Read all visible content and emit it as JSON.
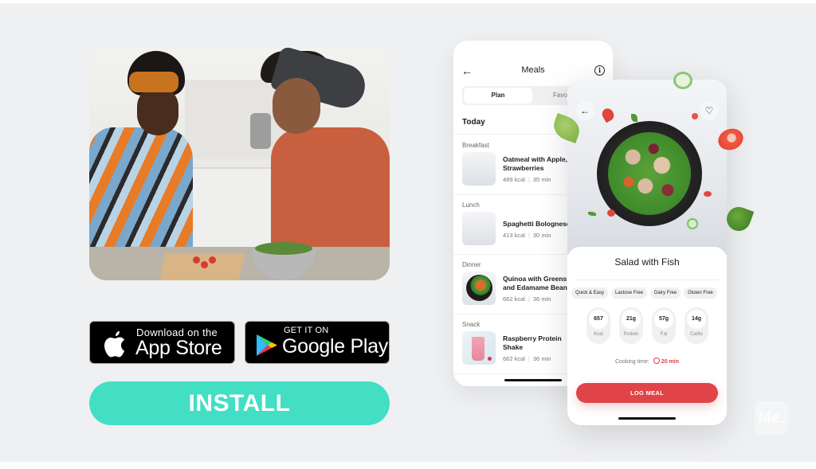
{
  "hero": {
    "alt": "Two women preparing a salad together in a kitchen"
  },
  "store_badges": {
    "apple": {
      "small": "Download on the",
      "big": "App Store",
      "icon": "apple-icon"
    },
    "google": {
      "small": "GET IT ON",
      "big": "Google Play",
      "icon": "google-play-icon"
    }
  },
  "install": {
    "label": "INSTALL",
    "color": "#42dfc4"
  },
  "meals_screen": {
    "back_icon": "←",
    "title": "Meals",
    "info_icon": "i",
    "tabs": [
      {
        "label": "Plan",
        "active": true
      },
      {
        "label": "Favo",
        "active": false
      }
    ],
    "section_title": "Today",
    "meals": [
      {
        "category": "Breakfast",
        "name_line1": "Oatmeal with Apple,",
        "name_line2": "Strawberries",
        "kcal": "489 kcal",
        "time": "35 min"
      },
      {
        "category": "Lunch",
        "name_line1": "Spaghetti Bolognese",
        "name_line2": "",
        "kcal": "413 kcal",
        "time": "30 min"
      },
      {
        "category": "Dinner",
        "name_line1": "Quinoa with Greens",
        "name_line2": "and Edamame Beans",
        "kcal": "662 kcal",
        "time": "36 min"
      },
      {
        "category": "Snack",
        "name_line1": "Raspberry Protein",
        "name_line2": "Shake",
        "kcal": "662 kcal",
        "time": "36 min"
      }
    ]
  },
  "detail_screen": {
    "back_icon": "←",
    "heart_icon": "♡",
    "title": "Salad with Fish",
    "tags": [
      "Quick & Easy",
      "Lactose Free",
      "Dairy Free",
      "Gluten Free"
    ],
    "nutrition": [
      {
        "value": "657",
        "label": "Kcal"
      },
      {
        "value": "21g",
        "label": "Protein"
      },
      {
        "value": "57g",
        "label": "Fat"
      },
      {
        "value": "14g",
        "label": "Carbs"
      }
    ],
    "cooking_label": "Cooking time:",
    "cooking_time": "20 min",
    "cta": "LOG MEAL",
    "accent": "#e04448"
  },
  "watermark": "Me."
}
